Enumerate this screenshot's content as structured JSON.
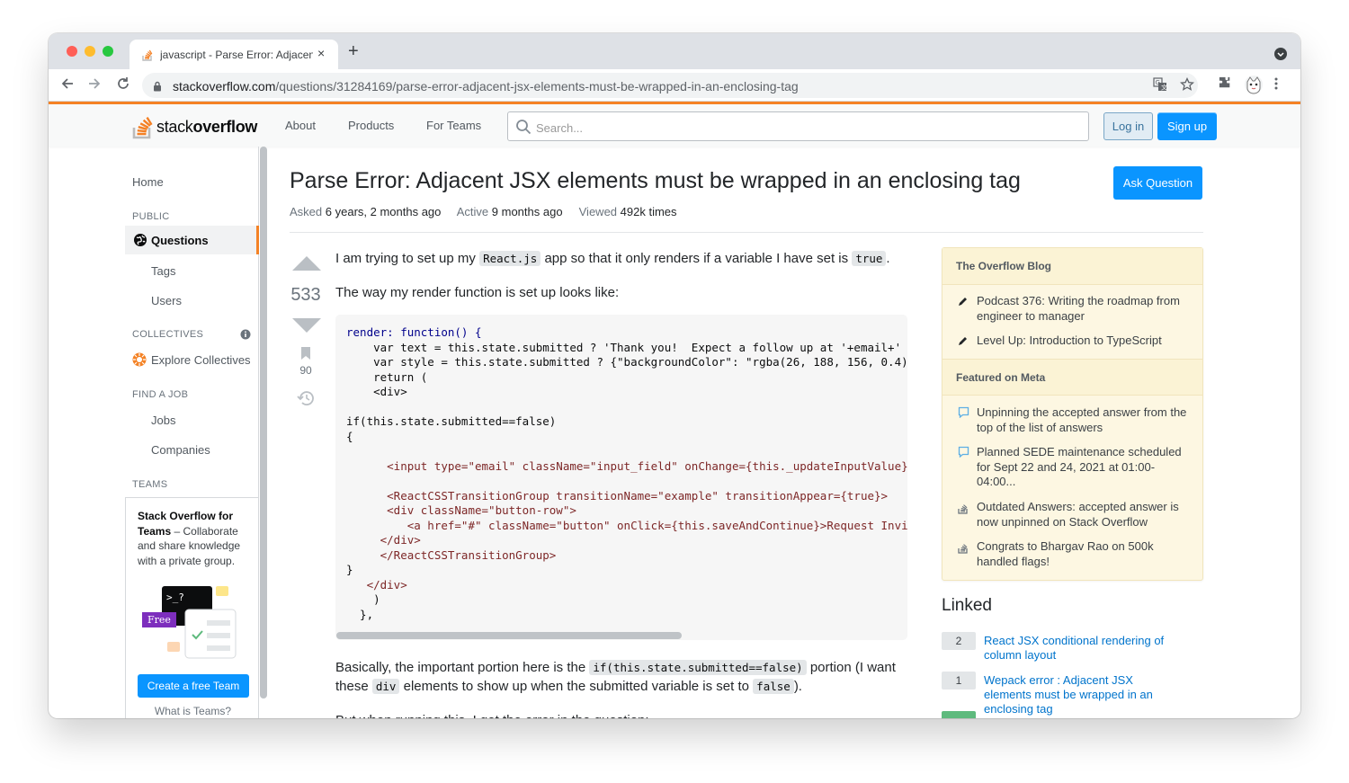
{
  "browser": {
    "tab_title": "javascript - Parse Error: Adjacent JSX elements must be wrapped in an enclosing tag",
    "close_glyph": "×",
    "new_tab_glyph": "+",
    "url_host": "stackoverflow.com",
    "url_path": "/questions/31284169/parse-error-adjacent-jsx-elements-must-be-wrapped-in-an-enclosing-tag",
    "traffic_lights": [
      "#ff5f57",
      "#febc2e",
      "#28c840"
    ]
  },
  "header": {
    "logo_light": "stack",
    "logo_bold": "overflow",
    "nav": [
      "About",
      "Products",
      "For Teams"
    ],
    "search_placeholder": "Search...",
    "login": "Log in",
    "signup": "Sign up",
    "accent": "#f48225",
    "primary": "#0a95ff"
  },
  "leftnav": {
    "home": "Home",
    "public": "PUBLIC",
    "questions": "Questions",
    "tags": "Tags",
    "users": "Users",
    "collectives": "COLLECTIVES",
    "explore_collectives": "Explore Collectives",
    "find_job": "FIND A JOB",
    "jobs": "Jobs",
    "companies": "Companies",
    "teams": "TEAMS",
    "teams_title": "Stack Overflow for Teams",
    "teams_desc": " – Collaborate and share knowledge with a private group.",
    "free_badge": "Free",
    "create_team": "Create a free Team",
    "what_is_teams": "What is Teams?"
  },
  "question": {
    "title": "Parse Error: Adjacent JSX elements must be wrapped in an enclosing tag",
    "ask_button": "Ask Question",
    "asked_label": "Asked",
    "asked_value": "6 years, 2 months ago",
    "active_label": "Active",
    "active_value": "9 months ago",
    "viewed_label": "Viewed",
    "viewed_value": "492k times",
    "votes": "533",
    "bookmarks": "90",
    "p1_a": "I am trying to set up my ",
    "p1_code1": "React.js",
    "p1_b": " app so that it only renders if a variable I have set is ",
    "p1_code2": "true",
    "p1_c": ".",
    "p2": "The way my render function is set up looks like:",
    "p3_a": "Basically, the important portion here is the ",
    "p3_code": "if(this.state.submitted==false)",
    "p3_b": " portion (I want",
    "p4_a": "these ",
    "p4_code1": "div",
    "p4_b": " elements to show up when the submitted variable is set to ",
    "p4_code2": "false",
    "p4_c": ").",
    "p5": "But when running this, I get the error in the question:"
  },
  "code_lines": [
    "render: function() {",
    "    var text = this.state.submitted ? 'Thank you!  Expect a follow up at '+email+' soon!' : 'Enter your email to request early access:';",
    "    var style = this.state.submitted ? {\"backgroundColor\": \"rgba(26, 188, 156, 0.4)\"} : {};",
    "    return (",
    "    <div>",
    "",
    "if(this.state.submitted==false)",
    "{",
    "",
    "      <input type=\"email\" className=\"input_field\" onChange={this._updateInputValue} ref=\"email\" value={this.state.email} />",
    "",
    "      <ReactCSSTransitionGroup transitionName=\"example\" transitionAppear={true}>",
    "      <div className=\"button-row\">",
    "         <a href=\"#\" className=\"button\" onClick={this.saveAndContinue}>Request Invite</a>",
    "     </div>",
    "     </ReactCSSTransitionGroup>",
    "}",
    "   </div>",
    "    )",
    "  },"
  ],
  "sidebar": {
    "blog_header": "The Overflow Blog",
    "blog_items": [
      "Podcast 376: Writing the roadmap from engineer to manager",
      "Level Up: Introduction to TypeScript"
    ],
    "meta_header": "Featured on Meta",
    "meta_items": [
      "Unpinning the accepted answer from the top of the list of answers",
      "Planned SEDE maintenance scheduled for Sept 22 and 24, 2021 at 01:00-04:00...",
      "Outdated Answers: accepted answer is now unpinned on Stack Overflow",
      "Congrats to Bhargav Rao on 500k handled flags!"
    ],
    "linked_header": "Linked",
    "linked": [
      {
        "score": "2",
        "title": "React JSX conditional rendering of column layout"
      },
      {
        "score": "1",
        "title": "Wepack error : Adjacent JSX elements must be wrapped in an enclosing tag"
      }
    ]
  }
}
